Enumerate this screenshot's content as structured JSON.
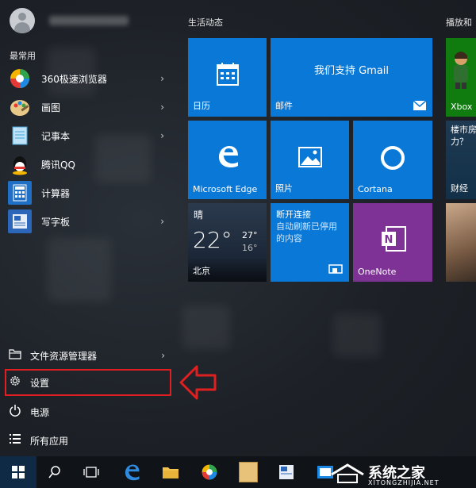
{
  "left": {
    "frequent_label": "最常用",
    "apps": [
      {
        "label": "360极速浏览器",
        "icon": "360-browser-icon"
      },
      {
        "label": "画图",
        "icon": "paint-icon"
      },
      {
        "label": "记事本",
        "icon": "notepad-icon"
      },
      {
        "label": "腾讯QQ",
        "icon": "qq-icon"
      },
      {
        "label": "计算器",
        "icon": "calculator-icon"
      },
      {
        "label": "写字板",
        "icon": "wordpad-icon"
      }
    ],
    "system": [
      {
        "label": "文件资源管理器",
        "icon": "file-explorer-icon"
      },
      {
        "label": "设置",
        "icon": "gear-icon"
      },
      {
        "label": "电源",
        "icon": "power-icon"
      },
      {
        "label": "所有应用",
        "icon": "all-apps-icon"
      }
    ]
  },
  "tiles": {
    "group1_title": "生活动态",
    "group2_title": "播放和",
    "calendar": "日历",
    "mail_headline": "我们支持 Gmail",
    "mail": "邮件",
    "edge": "Microsoft Edge",
    "photos": "照片",
    "cortana": "Cortana",
    "weather_cond": "晴",
    "weather_temp": "22°",
    "weather_high": "27°",
    "weather_low": "16°",
    "weather_city": "北京",
    "connect_title": "断开连接",
    "connect_desc": "自动刷新已停用的内容",
    "onenote": "OneNote",
    "xbox": "Xbox",
    "money_text": "楼市房\n力？",
    "money": "财经"
  },
  "watermark": {
    "text": "系统之家",
    "url": "XITONGZHIJIA.NET"
  },
  "colors": {
    "tile_blue": "#0a78d7",
    "onenote_purple": "#7e3296",
    "highlight_red": "#e02020"
  }
}
